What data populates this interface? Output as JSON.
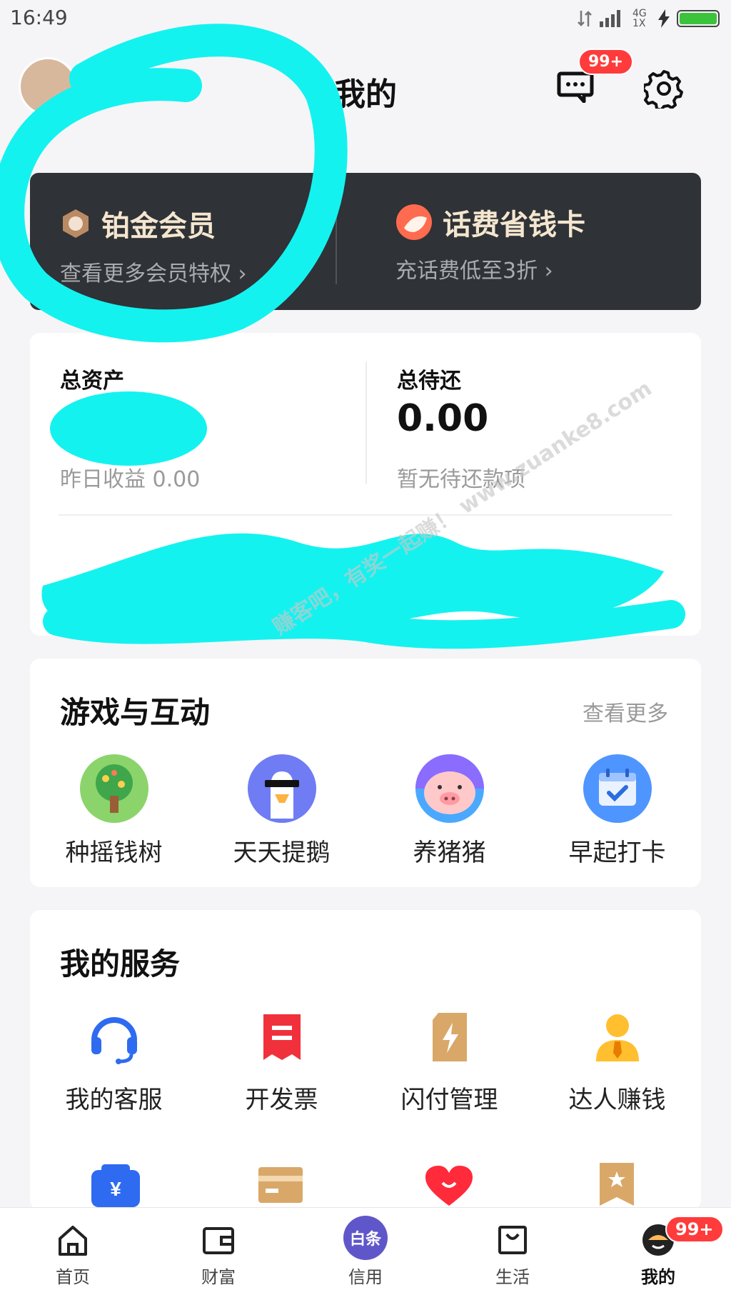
{
  "status_bar": {
    "time": "16:49",
    "network": "4G 1X"
  },
  "header": {
    "title": "我的",
    "message_badge": "99+"
  },
  "member_banner": {
    "left": {
      "title": "铂金会员",
      "subtitle": "查看更多会员特权 ›"
    },
    "right": {
      "title": "话费省钱卡",
      "subtitle": "充话费低至3折 ›"
    }
  },
  "assets": {
    "left_label": "总资产",
    "left_sub": "昨日收益 0.00",
    "right_label": "总待还",
    "right_value": "0.00",
    "right_sub": "暂无待还款项"
  },
  "games": {
    "title": "游戏与互动",
    "more": "查看更多",
    "items": [
      {
        "label": "种摇钱树",
        "icon": "money-tree-icon"
      },
      {
        "label": "天天提鹅",
        "icon": "goose-icon"
      },
      {
        "label": "养猪猪",
        "icon": "pig-icon"
      },
      {
        "label": "早起打卡",
        "icon": "calendar-checkin-icon"
      }
    ]
  },
  "services": {
    "title": "我的服务",
    "items": [
      {
        "label": "我的客服",
        "icon": "headset-icon"
      },
      {
        "label": "开发票",
        "icon": "invoice-icon"
      },
      {
        "label": "闪付管理",
        "icon": "flash-pay-icon"
      },
      {
        "label": "达人赚钱",
        "icon": "expert-earn-icon"
      }
    ]
  },
  "tab_bar": {
    "items": [
      {
        "label": "首页",
        "icon": "home-icon"
      },
      {
        "label": "财富",
        "icon": "wallet-icon"
      },
      {
        "label": "信用",
        "icon": "credit-icon",
        "icon_text": "白条"
      },
      {
        "label": "生活",
        "icon": "shopping-bag-icon"
      },
      {
        "label": "我的",
        "icon": "profile-icon"
      }
    ],
    "profile_badge": "99+"
  },
  "watermark": "赚客吧，有奖一起赚！ www.zuanke8.com",
  "colors": {
    "background": "#f5f5f7",
    "banner_bg": "#2f3236",
    "banner_title": "#f4e6cf",
    "badge_red": "#ff3b3b",
    "scribble": "#14f2f0"
  }
}
